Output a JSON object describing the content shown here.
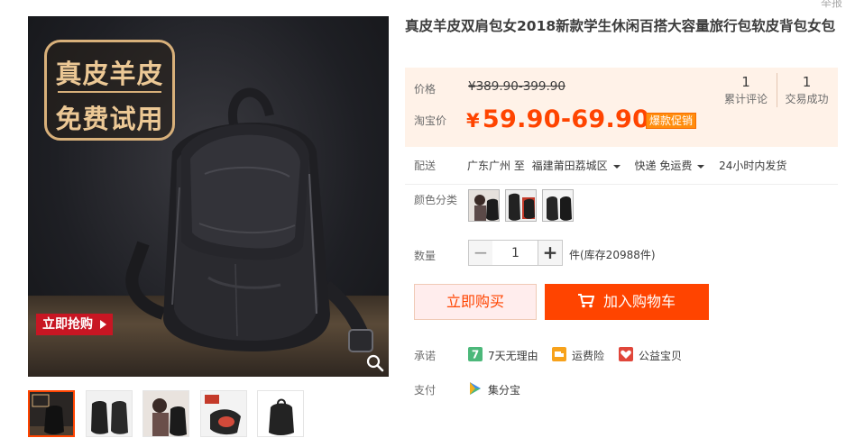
{
  "gallery": {
    "badge_line1": "真皮羊皮",
    "badge_line2": "免费试用",
    "buy_tag": "立即抢购",
    "zoom_icon": "magnifier-icon",
    "thumb_count": 5
  },
  "product": {
    "title": "真皮羊皮双肩包女2018新款学生休闲百搭大容量旅行包软皮背包女包",
    "corner_label": "举报"
  },
  "price": {
    "label_price": "价格",
    "original": "¥389.90-399.90",
    "label_taobao": "淘宝价",
    "currency": "¥",
    "current": "59.90-69.90",
    "promo_tag": "爆款促销"
  },
  "stats": {
    "reviews_count": "1",
    "reviews_label": "累计评论",
    "sales_count": "1",
    "sales_label": "交易成功"
  },
  "shipping": {
    "label": "配送",
    "from": "广东广州 至",
    "to": "福建莆田荔城区",
    "method": "快递 免运费",
    "dispatch": "24小时内发货"
  },
  "colors": {
    "label": "颜色分类"
  },
  "quantity": {
    "label": "数量",
    "minus": "−",
    "value": "1",
    "plus": "+",
    "stock": "件(库存20988件)"
  },
  "actions": {
    "buy_now": "立即购买",
    "add_to_cart": "加入购物车"
  },
  "promise": {
    "label": "承诺",
    "items": [
      "7天无理由",
      "运费险",
      "公益宝贝"
    ]
  },
  "payment": {
    "label": "支付",
    "method": "集分宝"
  },
  "colors_theme": {
    "accent": "#ff4400",
    "price_bg": "#fff2e8",
    "promo": "#ff8d0e"
  }
}
